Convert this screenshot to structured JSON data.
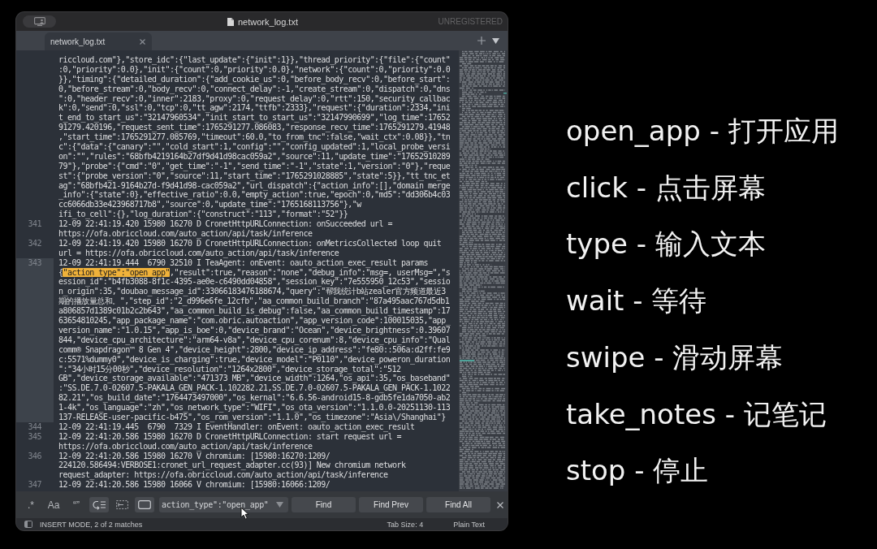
{
  "window": {
    "title": "network_log.txt",
    "license_notice": "UNREGISTERED"
  },
  "tabs": [
    {
      "label": "network_log.txt",
      "selected": true
    }
  ],
  "editor": {
    "lines": [
      {
        "current": false,
        "rows": [
          "riccloud.com\"},\"store_idc\":{\"last_update\":{\"init\":1}},\"thread_priority\":{\"file\":{\"count\"",
          ":0,\"priority\":0.0},\"init\":{\"count\":0,\"priority\":0.0},\"network\":{\"count\":0,\"priority\":0.0",
          "}},\"timing\":{\"detailed_duration\":{\"add_cookie_us\":0,\"before_body_recv\":0,\"before_start\":",
          "0,\"before_stream\":0,\"body_recv\":0,\"connect_delay\":-1,\"create_stream\":0,\"dispatch\":0,\"dns",
          "\":0,\"header_recv\":0,\"inner\":2183,\"proxy\":0,\"request_delay\":0,\"rtt\":150,\"security_callbac",
          "k\":0,\"send\":0,\"ssl\":0,\"tcp\":0,\"tt_agw\":2174,\"ttfb\":2333},\"request\":{\"duration\":2334,\"ini",
          "t_end_to_start_us\":\"32147960534\",\"init_start_to_start_us\":\"32147990699\",\"log_time\":17652",
          "91279.420196,\"request_sent_time\":1765291277.086083,\"response_recv_time\":1765291279.41948",
          ",\"start_time\":1765291277.085769,\"timeout\":60.0,\"to_from_tnc\":false,\"wait_ctx\":0.08}},\"tn",
          "c\":{\"data\":{\"canary\":\"\",\"cold_start\":1,\"config\":\"\",\"config_updated\":1,\"local_probe_versi",
          "on\":\"\",\"rules\":\"68bfb4219164b27df9d41d98cac059a2\",\"source\":11,\"update_time\":\"17652910289",
          "79\"},\"probe\":{\"cmd\":\"0\",\"get_time\":\"-1\",\"send_time\":\"-1\",\"state\":1,\"version\":\"0\"},\"reque",
          "st\":{\"probe_version\":\"0\",\"source\":11,\"start_time\":\"1765291028885\",\"state\":5}},\"tt_tnc_et",
          "ag\":\"68bfb421-9164b27d-f9d41d98-cac059a2\",\"url_dispatch\":{\"action_info\":[],\"domain_merge",
          "_info\":{\"state\":0},\"effective_ratio\":0.0,\"empty_action\":true,\"epoch\":0,\"md5\":\"dd306b4c03",
          "cc6066db33e423968717b8\",\"source\":0,\"update_time\":\"1765168113756\"},\"w",
          "ifi_to_cell\":{},\"log_duration\":{\"construct\":\"113\",\"format\":\"52\"}}"
        ]
      },
      {
        "number": "341",
        "current": false,
        "rows": [
          "12-09 22:41:19.420 15980 16270 D CronetHttpURLConnection: onSucceeded url =",
          "https://ofa.obriccloud.com/auto_action/api/task/inference"
        ]
      },
      {
        "number": "342",
        "current": false,
        "rows": [
          "12-09 22:41:19.420 15980 16270 D CronetHttpURLConnection: onMetricsCollected loop quit",
          "url = https://ofa.obriccloud.com/auto_action/api/task/inference"
        ]
      },
      {
        "number": "343",
        "current": true,
        "rows": [
          "12-09 22:41:19.444  6790 32510 I TeaAgent: onEvent: oauto_action_exec_result params",
          {
            "text_before": "{",
            "match": "\"action_type\":\"open_app\"",
            "text_after": ",\"result\":true,\"reason\":\"none\",\"debug_info\":\"msg=, userMsg=\",\"s"
          },
          "ession_id\":\"b4fb3088-8f1c-4395-ae0e-c6490dd04858\",\"session_key\":\"7e555950_12c53\",\"sessio",
          "n_origin\":35,\"doubao_message_id\":33066183476188674,\"query\":\"帮我统计b站zealer官方频道最近3",
          "期的播放量总和。\",\"step_id\":\"2_d996e6fe_12cfb\",\"aa_common_build_branch\":\"87a495aac767d5db1",
          "a806857d1389c01b2c2b643\",\"aa_common_build_is_debug\":false,\"aa_common_build_timestamp\":17",
          "63654810245,\"app_package_name\":\"com.obric.autoaction\",\"app_version_code\":100015035,\"app_",
          "version_name\":\"1.0.15\",\"app_is_boe\":0,\"device_brand\":\"Ocean\",\"device_brightness\":0.39607",
          "844,\"device_cpu_architecture\":\"arm64-v8a\",\"device_cpu_corenum\":8,\"device_cpu_info\":\"Qual",
          "comm® Snapdragon™ 8 Gen 4\",\"device_height\":2800,\"device_ip_address\":\"fe80::506a:d2ff:fe9",
          "c:5571%dummy0\",\"device_is_charging\":true,\"device_model\":\"P0110\",\"device_poweron_duration",
          "\":\"34小时15分00秒\",\"device_resolution\":\"1264x2800\",\"device_storage_total\":\"512",
          "GB\",\"device_storage_available\":\"471373 MB\",\"device_width\":1264,\"os_api\":35,\"os_baseband\"",
          ":\"SS.DE.7.0-02607.5-PAKALA_GEN_PACK-1.102282.21,SS.DE.7.0-02607.5-PAKALA_GEN_PACK-1.1022",
          "82.21\",\"os_build_date\":\"1764473497000\",\"os_kernal\":\"6.6.56-android15-8-gdb5fe1da7050-ab2",
          "1-4k\",\"os_language\":\"zh\",\"os_network_type\":\"WIFI\",\"os_ota_version\":\"1.1.0.0-20251130-113",
          "137-RELEASE-user-pacific-b475\",\"os_rom_version\":\"1.1.0\",\"os_timezone\":\"Asia\\/Shanghai\"}"
        ]
      },
      {
        "number": "344",
        "current": false,
        "rows": [
          "12-09 22:41:19.445  6790  7329 I EventHandler: onEvent: oauto_action_exec_result"
        ]
      },
      {
        "number": "345",
        "current": false,
        "rows": [
          "12-09 22:41:20.586 15980 16270 D CronetHttpURLConnection: start request url =",
          "https://ofa.obriccloud.com/auto_action/api/task/inference"
        ]
      },
      {
        "number": "346",
        "current": false,
        "rows": [
          "12-09 22:41:20.586 15980 16270 V chromium: [15980:16270:1209/",
          "224120.586494:VERBOSE1:cronet_url_request_adapter.cc(93)] New chromium network",
          "request_adapter: https://ofa.obriccloud.com/auto_action/api/task/inference"
        ]
      },
      {
        "number": "347",
        "current": false,
        "rows": [
          "12-09 22:41:20.586 15980 16066 V chromium: [15980:16066:1209/"
        ]
      }
    ]
  },
  "find_bar": {
    "toggles": [
      {
        "kind": "glyph",
        "label": ".*",
        "on": false
      },
      {
        "kind": "glyph",
        "label": "Aa",
        "on": false
      },
      {
        "kind": "glyph",
        "label": "“”",
        "on": false
      },
      {
        "kind": "wrap",
        "on": true
      },
      {
        "kind": "selection",
        "on": false
      },
      {
        "kind": "highlight",
        "on": true
      }
    ],
    "query": "action_type\":\"open_app\"",
    "buttons": [
      "Find",
      "Find Prev",
      "Find All"
    ]
  },
  "status_bar": {
    "mode": "INSERT MODE, 2 of 2 matches",
    "tab_size": "Tab Size: 4",
    "syntax": "Plain Text"
  },
  "action_list": [
    "open_app - 打开应用",
    "click - 点击屏幕",
    "type - 输入文本",
    "wait - 等待",
    "swipe - 滑动屏幕",
    "take_notes - 记笔记",
    "stop - 停止"
  ]
}
